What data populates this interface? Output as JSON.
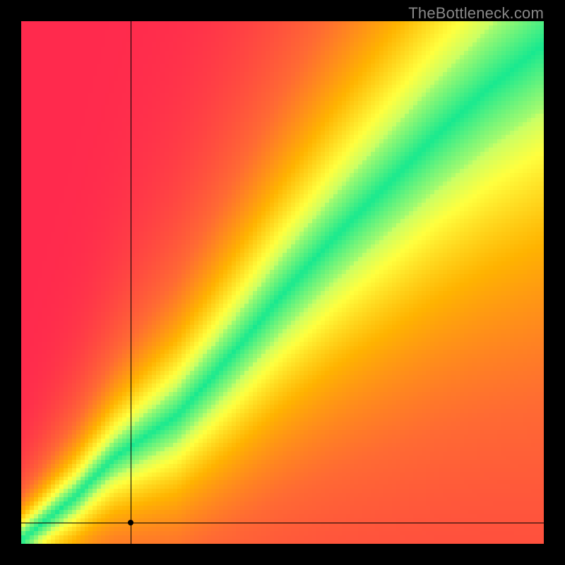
{
  "watermark": "TheBottleneck.com",
  "chart_data": {
    "type": "heatmap",
    "title": "",
    "xlabel": "",
    "ylabel": "",
    "xlim": [
      0,
      100
    ],
    "ylim": [
      0,
      100
    ],
    "crosshair": {
      "x": 21,
      "y": 4
    },
    "ridge": [
      {
        "x": 0,
        "y": 0
      },
      {
        "x": 10,
        "y": 8
      },
      {
        "x": 18,
        "y": 16
      },
      {
        "x": 24,
        "y": 20
      },
      {
        "x": 30,
        "y": 24
      },
      {
        "x": 40,
        "y": 35
      },
      {
        "x": 50,
        "y": 47
      },
      {
        "x": 60,
        "y": 58
      },
      {
        "x": 70,
        "y": 68
      },
      {
        "x": 80,
        "y": 78
      },
      {
        "x": 90,
        "y": 87
      },
      {
        "x": 100,
        "y": 95
      }
    ],
    "ridge_width": [
      {
        "x": 0,
        "w": 2
      },
      {
        "x": 15,
        "w": 3
      },
      {
        "x": 30,
        "w": 5
      },
      {
        "x": 50,
        "w": 7
      },
      {
        "x": 70,
        "w": 9
      },
      {
        "x": 100,
        "w": 12
      }
    ],
    "color_stops": [
      {
        "t": 0.0,
        "color": "#ff2a4d"
      },
      {
        "t": 0.3,
        "color": "#ff6a33"
      },
      {
        "t": 0.55,
        "color": "#ffb300"
      },
      {
        "t": 0.78,
        "color": "#ffff3e"
      },
      {
        "t": 0.9,
        "color": "#c8ff66"
      },
      {
        "t": 1.0,
        "color": "#18e98f"
      }
    ]
  }
}
